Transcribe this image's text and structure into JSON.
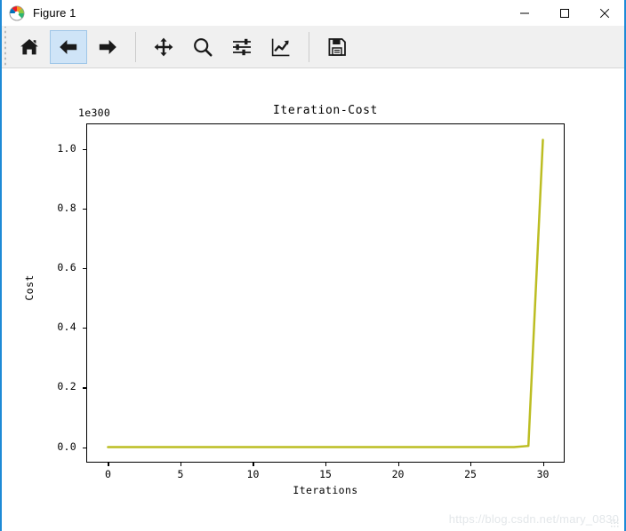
{
  "window": {
    "title": "Figure 1",
    "icon": "matplotlib-icon",
    "controls": {
      "minimize": "–",
      "maximize": "□",
      "close": "✕"
    }
  },
  "toolbar": {
    "buttons": [
      {
        "name": "home-icon",
        "tooltip": "Reset original view",
        "state": "normal"
      },
      {
        "name": "arrow-left-icon",
        "tooltip": "Back to previous view",
        "state": "hover"
      },
      {
        "name": "arrow-right-icon",
        "tooltip": "Forward to next view",
        "state": "normal"
      },
      {
        "name": "move-icon",
        "tooltip": "Pan axes with left mouse, zoom with right",
        "state": "normal"
      },
      {
        "name": "magnifier-icon",
        "tooltip": "Zoom to rectangle",
        "state": "normal"
      },
      {
        "name": "sliders-icon",
        "tooltip": "Configure subplots",
        "state": "normal"
      },
      {
        "name": "chart-line-icon",
        "tooltip": "Edit axis, curve and image parameters",
        "state": "normal"
      },
      {
        "name": "floppy-disk-icon",
        "tooltip": "Save the figure",
        "state": "normal"
      }
    ]
  },
  "chart_data": {
    "type": "line",
    "title": "Iteration-Cost",
    "xlabel": "Iterations",
    "ylabel": "Cost",
    "y_offset_label": "1e300",
    "y_offset_value": 1e+300,
    "xlim": [
      -1.5,
      31.5
    ],
    "ylim": [
      -0.052,
      1.085
    ],
    "xticks": [
      0,
      5,
      10,
      15,
      20,
      25,
      30
    ],
    "xticklabels": [
      "0",
      "5",
      "10",
      "15",
      "20",
      "25",
      "30"
    ],
    "yticks": [
      0.0,
      0.2,
      0.4,
      0.6,
      0.8,
      1.0
    ],
    "yticklabels": [
      "0.0",
      "0.2",
      "0.4",
      "0.6",
      "0.8",
      "1.0"
    ],
    "grid": false,
    "legend": null,
    "series": [
      {
        "name": "Cost",
        "color": "#bcbd22",
        "linewidth": 2.5,
        "x": [
          0,
          1,
          2,
          3,
          4,
          5,
          6,
          7,
          8,
          9,
          10,
          11,
          12,
          13,
          14,
          15,
          16,
          17,
          18,
          19,
          20,
          21,
          22,
          23,
          24,
          25,
          26,
          27,
          28,
          29,
          30
        ],
        "values": [
          0,
          0,
          0,
          0,
          0,
          0,
          0,
          0,
          0,
          0,
          0,
          0,
          0,
          0,
          0,
          0,
          0,
          0,
          0,
          0,
          0,
          0,
          0,
          0,
          0,
          0,
          0,
          0,
          0,
          0.004,
          1.03
        ]
      }
    ]
  },
  "watermark": {
    "text": "https://blog.csdn.net/mary_0830"
  }
}
